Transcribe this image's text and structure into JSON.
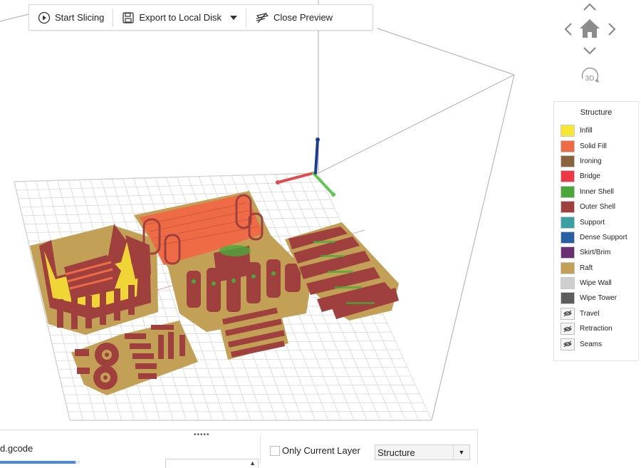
{
  "toolbar": {
    "start_slicing": "Start Slicing",
    "export_label": "Export to Local Disk",
    "close_preview": "Close Preview"
  },
  "nav": {
    "view_3d": "3D"
  },
  "legend": {
    "title": "Structure",
    "items": [
      {
        "label": "Infill",
        "color": "#f7e634",
        "hidden": false
      },
      {
        "label": "Solid Fill",
        "color": "#ee6b45",
        "hidden": false
      },
      {
        "label": "Ironing",
        "color": "#8a623c",
        "hidden": false
      },
      {
        "label": "Bridge",
        "color": "#ee3846",
        "hidden": false
      },
      {
        "label": "Inner Shell",
        "color": "#4aa83a",
        "hidden": false
      },
      {
        "label": "Outer Shell",
        "color": "#a0403e",
        "hidden": false
      },
      {
        "label": "Support",
        "color": "#3aa0a4",
        "hidden": false
      },
      {
        "label": "Dense Support",
        "color": "#2860a6",
        "hidden": false
      },
      {
        "label": "Skirt/Brim",
        "color": "#6a2e72",
        "hidden": false
      },
      {
        "label": "Raft",
        "color": "#c2a055",
        "hidden": false
      },
      {
        "label": "Wipe Wall",
        "color": "#cfcfcf",
        "hidden": false
      },
      {
        "label": "Wipe Tower",
        "color": "#5d5d5d",
        "hidden": false
      },
      {
        "label": "Travel",
        "color": "",
        "hidden": true
      },
      {
        "label": "Retraction",
        "color": "",
        "hidden": true
      },
      {
        "label": "Seams",
        "color": "",
        "hidden": true
      }
    ]
  },
  "bottom": {
    "grip": "•••••",
    "file_label": "d.gcode",
    "progress": 0.95,
    "layer_value": "",
    "only_current_layer": "Only Current Layer",
    "only_current_checked": false,
    "view_mode": "Structure"
  }
}
